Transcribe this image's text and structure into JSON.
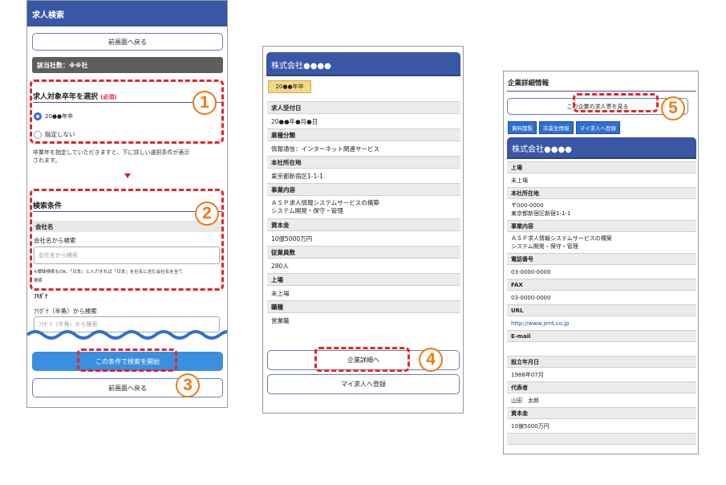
{
  "p1": {
    "header": "求人検索",
    "back_top": "前画面へ戻る",
    "company_count": "該当社数：※※社",
    "grad_title": "求人対象卒年を選択",
    "required": "(必須)",
    "radio1": "20●●年卒",
    "radio2": "指定しない",
    "note": [
      "卒業年を指定していただきますと、下に詳しい選択条件が表示",
      "されます。"
    ],
    "search_cond": "検索条件",
    "company_label": "会社名",
    "company_search": "会社名から検索",
    "company_placeholder": "会社名から検索",
    "fuzzy_note": [
      "※曖昧検索もOK。「日本」と入力すれば「日本」を社名に含む会社名を全て",
      "検索"
    ],
    "furigana_label": "ﾌﾘｶﾞﾅ",
    "furigana_search": "ﾌﾘｶﾞﾅ（半角）から検索",
    "furigana_placeholder": "ﾌﾘｶﾞﾅ（半角）から検索",
    "start_search": "この条件で検索を開始",
    "back_bottom": "前画面へ戻る"
  },
  "p2": {
    "company": "株式会社●●●●",
    "badge": "20●●年卒",
    "rows": [
      {
        "label": "求人受付日",
        "value": [
          "20●●年●月●日"
        ]
      },
      {
        "label": "業種分類",
        "value": [
          "情報通信：インターネット関連サービス"
        ]
      },
      {
        "label": "本社所在地",
        "value": [
          "東京都新宿区1-1-1"
        ]
      },
      {
        "label": "事業内容",
        "value": [
          "ＡＳＰ求人情報システムサービスの構築",
          "システム開発・保守・管理"
        ]
      },
      {
        "label": "資本金",
        "value": [
          "10億5000万円"
        ]
      },
      {
        "label": "従業員数",
        "value": [
          "280人"
        ]
      },
      {
        "label": "上場",
        "value": [
          "未上場"
        ]
      },
      {
        "label": "職種",
        "value": [
          "営業職"
        ]
      }
    ],
    "detail_btn": "企業詳細へ",
    "register_btn": "マイ求人へ登録"
  },
  "p3": {
    "title": "企業詳細情報",
    "view_btn": "この企業の求人票を見る",
    "tags": [
      "資料閲覧",
      "卒業生情報",
      "マイ求人へ登録"
    ],
    "company": "株式会社●●●●",
    "rows": [
      {
        "label": "上場",
        "value": [
          "未上場"
        ]
      },
      {
        "label": "本社所在地",
        "value": [
          "〒000-0000",
          "東京都新宿区新宿1-1-1"
        ]
      },
      {
        "label": "事業内容",
        "value": [
          "ＡＳＰ求人情報システムサービスの構築",
          "システム開発・保守・管理"
        ]
      },
      {
        "label": "電話番号",
        "value": [
          "03-0000-0000"
        ]
      },
      {
        "label": "FAX",
        "value": [
          "03-0000-0000"
        ]
      },
      {
        "label": "URL",
        "value": [
          "http://www.jent.co.jp"
        ]
      },
      {
        "label": "E-mail",
        "value": [
          ""
        ]
      },
      {
        "label": "設立年月日",
        "value": [
          "1988年07月"
        ]
      },
      {
        "label": "代表者",
        "value": [
          "山田　太郎"
        ]
      },
      {
        "label": "資本金",
        "value": [
          "10億5000万円"
        ]
      }
    ]
  },
  "markers": [
    "1",
    "2",
    "3",
    "4",
    "5"
  ],
  "colors": {
    "accent_blue": "#3b8fe0",
    "header_navy": "#3a57a6",
    "dash_red": "#e82424",
    "circle_orange": "#ee7a14"
  }
}
